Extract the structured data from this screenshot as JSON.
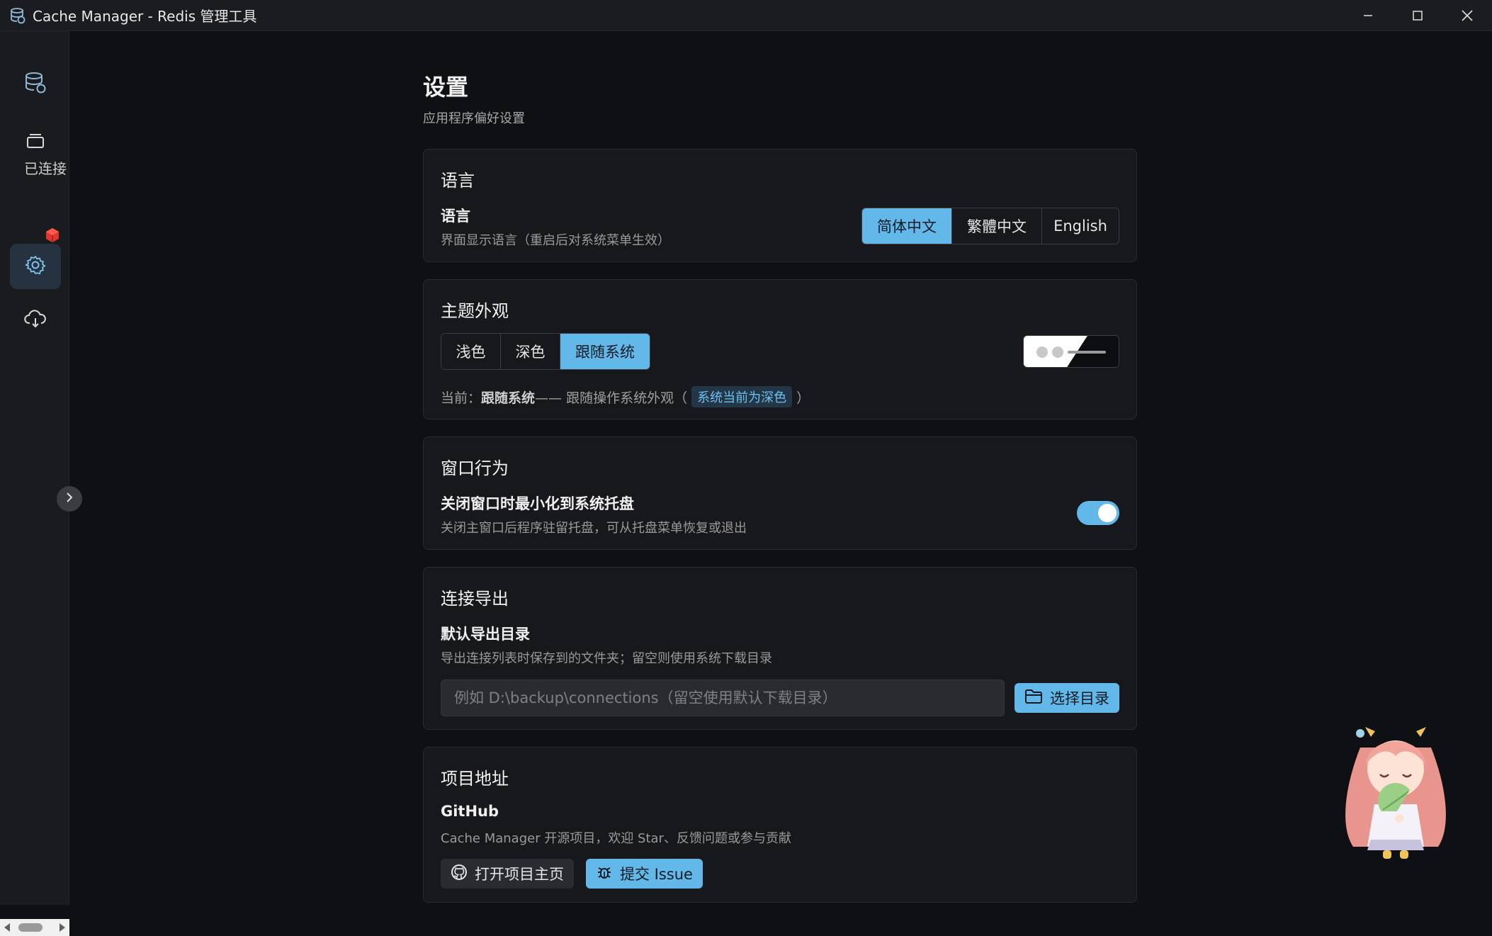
{
  "window": {
    "title": "Cache Manager - Redis 管理工具",
    "controls": [
      "minimize-icon",
      "maximize-icon",
      "close-icon"
    ]
  },
  "sidebar": {
    "items": [
      {
        "name": "database-icon"
      },
      {
        "name": "layers-icon"
      },
      {
        "label": "已连接"
      },
      {
        "name": "redis-connection-icon",
        "color": "#e0362f"
      },
      {
        "name": "gear-icon",
        "active": true
      },
      {
        "name": "cloud-download-icon"
      }
    ],
    "connected_label": "已连接"
  },
  "page": {
    "title": "设置",
    "subtitle": "应用程序偏好设置"
  },
  "language": {
    "section_title": "语言",
    "item_title": "语言",
    "item_desc": "界面显示语言（重启后对系统菜单生效）",
    "options": [
      "简体中文",
      "繁體中文",
      "English"
    ],
    "selected": "简体中文"
  },
  "theme": {
    "section_title": "主题外观",
    "options": [
      "浅色",
      "深色",
      "跟随系统"
    ],
    "selected": "跟随系统",
    "current_prefix": "当前：",
    "current_value": "跟随系统",
    "current_desc": "—— 跟随操作系统外观（",
    "current_tag": "系统当前为深色",
    "current_suffix": "）"
  },
  "window_behavior": {
    "section_title": "窗口行为",
    "item_title": "关闭窗口时最小化到系统托盘",
    "item_desc": "关闭主窗口后程序驻留托盘，可从托盘菜单恢复或退出",
    "enabled": true
  },
  "export": {
    "section_title": "连接导出",
    "item_title": "默认导出目录",
    "item_desc": "导出连接列表时保存到的文件夹；留空则使用系统下载目录",
    "input_value": "",
    "input_placeholder": "例如 D:\\backup\\connections（留空使用默认下载目录）",
    "choose_button": "选择目录"
  },
  "project": {
    "section_title": "项目地址",
    "item_title": "GitHub",
    "item_desc": "Cache Manager 开源项目，欢迎 Star、反馈问题或参与贡献",
    "open_button": "打开项目主页",
    "issue_button": "提交 Issue"
  },
  "colors": {
    "accent": "#63b8ea",
    "background": "#0f1013",
    "card": "#17181c",
    "sidebar": "#1a1b1f"
  }
}
